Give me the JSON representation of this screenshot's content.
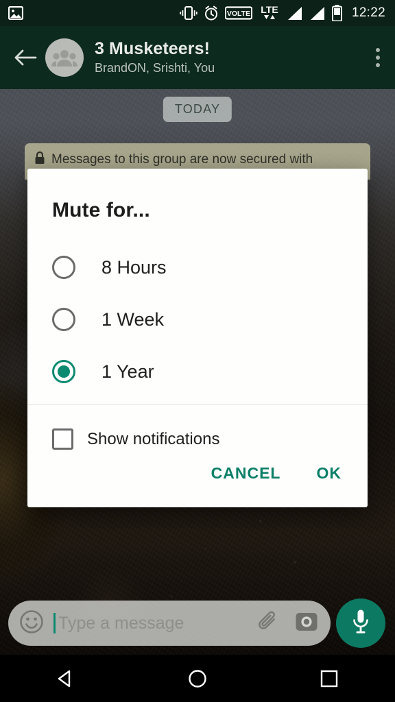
{
  "status_bar": {
    "time": "12:22",
    "icons": [
      "image-icon",
      "vibrate-icon",
      "alarm-icon",
      "volte-icon",
      "lte-icon",
      "signal-icon-1",
      "signal-icon-2",
      "battery-icon"
    ],
    "volte_label": "VOLTE",
    "lte_label": "LTE"
  },
  "app_bar": {
    "back_icon": "back-arrow-icon",
    "avatar_icon": "group-avatar-icon",
    "title": "3 Musketeers!",
    "subtitle": "BrandON, Srishti, You",
    "overflow_icon": "overflow-menu-icon"
  },
  "chat": {
    "date_chip": "TODAY",
    "encryption_notice": "Messages to this group are now secured with",
    "lock_icon": "lock-icon"
  },
  "dialog": {
    "title": "Mute for...",
    "options": [
      {
        "label": "8 Hours",
        "selected": false
      },
      {
        "label": "1 Week",
        "selected": false
      },
      {
        "label": "1 Year",
        "selected": true
      }
    ],
    "checkbox": {
      "label": "Show notifications",
      "checked": false
    },
    "cancel_label": "CANCEL",
    "ok_label": "OK",
    "accent_color": "#0b7f68"
  },
  "input_bar": {
    "emoji_icon": "emoji-icon",
    "placeholder": "Type a message",
    "value": "",
    "attach_icon": "paperclip-icon",
    "camera_icon": "camera-icon",
    "mic_icon": "microphone-icon",
    "mic_color": "#0c7a62"
  },
  "nav_bar": {
    "back_icon": "nav-back-triangle-icon",
    "home_icon": "nav-home-circle-icon",
    "recents_icon": "nav-recents-square-icon"
  }
}
